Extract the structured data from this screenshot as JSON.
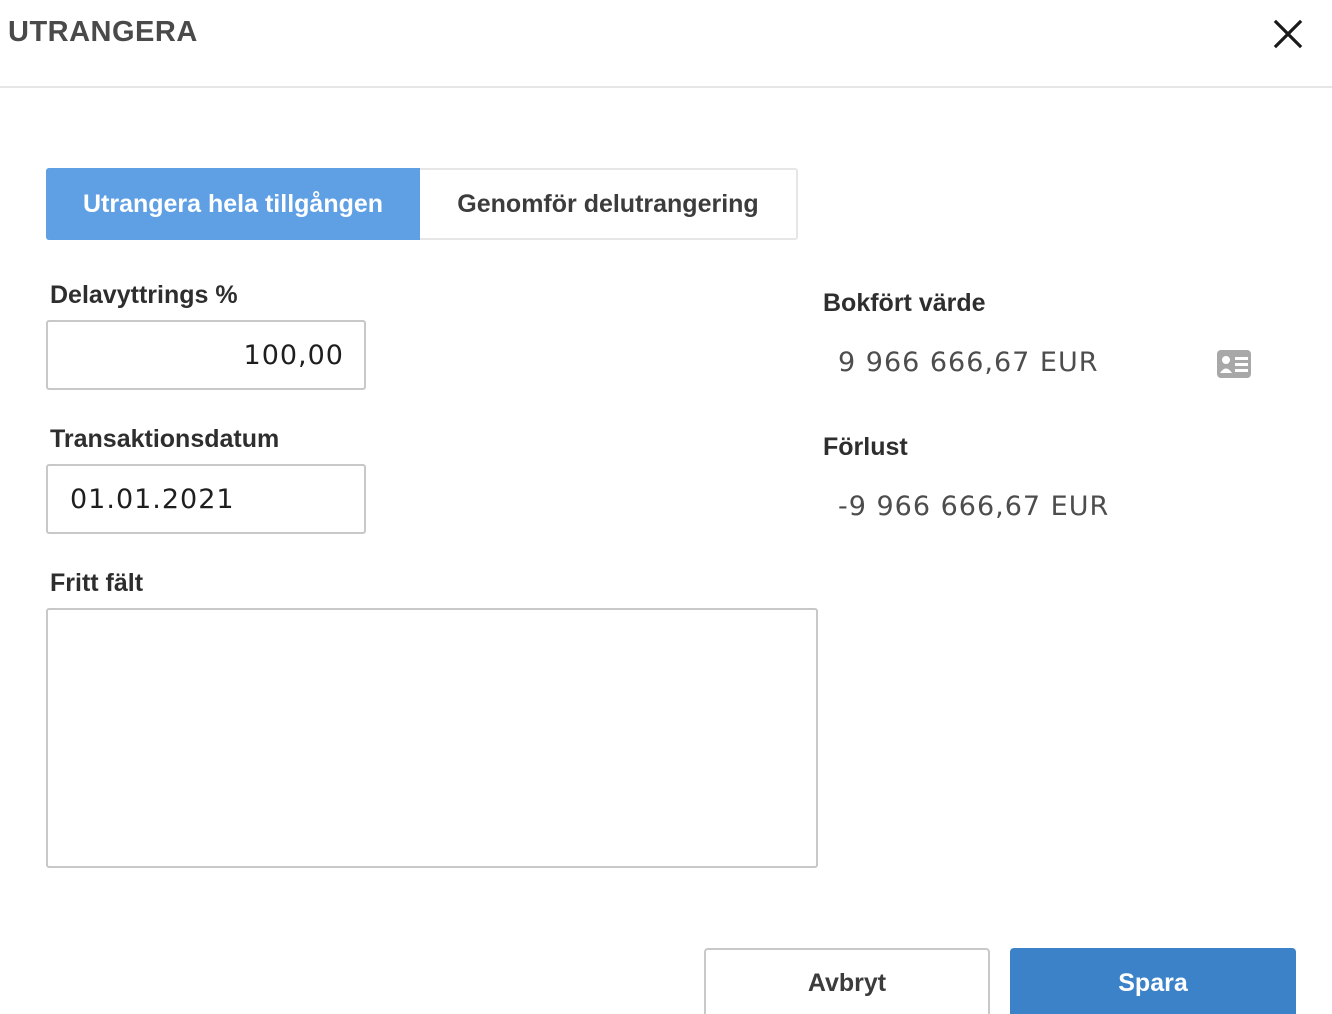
{
  "dialog": {
    "title": "UTRANGERA",
    "close_icon": "close-icon"
  },
  "mode_tabs": [
    {
      "label": "Utrangera hela tillgången",
      "active": true
    },
    {
      "label": "Genomför delutrangering",
      "active": false
    }
  ],
  "form": {
    "percent": {
      "label": "Delavyttrings %",
      "value": "100,00"
    },
    "date": {
      "label": "Transaktionsdatum",
      "value": "01.01.2021",
      "icon": "calendar-icon"
    },
    "free_field": {
      "label": "Fritt fält",
      "value": ""
    }
  },
  "summary": {
    "book_value": {
      "label": "Bokfört värde",
      "value": "9 966 666,67 EUR",
      "icon": "id-card-icon"
    },
    "loss": {
      "label": "Förlust",
      "value": "-9 966 666,67 EUR"
    }
  },
  "footer": {
    "cancel_label": "Avbryt",
    "save_label": "Spara"
  },
  "colors": {
    "active_tab": "#5f9fe4",
    "primary_button": "#3b82c9",
    "border": "#c8c8c8"
  }
}
